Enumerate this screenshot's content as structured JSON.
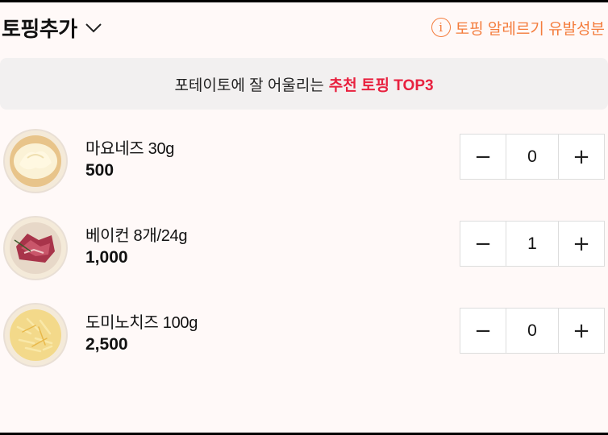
{
  "header": {
    "title": "토핑추가",
    "allergy_label": "토핑 알레르기 유발성분",
    "info_icon": "i"
  },
  "banner": {
    "prefix": "포테이토에 잘 어울리는",
    "highlight": "추천 토핑 TOP3"
  },
  "colors": {
    "accent_orange": "#f47c3c",
    "highlight_red": "#e8213f",
    "background": "#fff9f8"
  },
  "toppings": [
    {
      "name": "마요네즈 30g",
      "price": "500",
      "qty": "0",
      "icon": "mayonnaise-icon"
    },
    {
      "name": "베이컨 8개/24g",
      "price": "1,000",
      "qty": "1",
      "icon": "bacon-icon"
    },
    {
      "name": "도미노치즈 100g",
      "price": "2,500",
      "qty": "0",
      "icon": "cheese-icon"
    }
  ],
  "stepper": {
    "minus": "−",
    "plus": "+"
  }
}
